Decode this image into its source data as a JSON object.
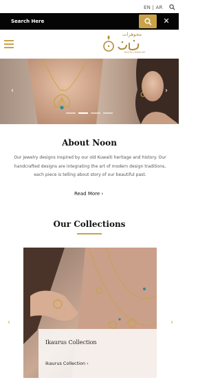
{
  "topbar": {
    "language": "EN | AR",
    "search_icon": "search-icon"
  },
  "search": {
    "placeholder": "Search Here",
    "button_icon": "search-icon",
    "close_label": "✕"
  },
  "header": {
    "menu_icon": "hamburger-icon",
    "logo_arabic": "مجوهرات",
    "logo_main_arabic": "نون",
    "logo_subtitle": "NOON JEWELRY"
  },
  "hero": {
    "prev_label": "‹",
    "next_label": "›",
    "slides": 4,
    "active_slide": 1
  },
  "about": {
    "title": "About Noon",
    "text": "Our jewelry  designs inspired by our old Kuwaiti heritage and history. Our handcrafted designs are integrating the art of modern design traditions, each piece is telling about story of our beautiful past.",
    "read_more": "Read More ›"
  },
  "collections": {
    "title": "Our Collections",
    "items": [
      {
        "name": "Ikaurus Collection",
        "link": "Ikaurus Collection ›"
      }
    ],
    "prev_label": "‹",
    "next_label": "›"
  },
  "colors": {
    "accent": "#c9a24a",
    "search_bg": "#050505"
  }
}
